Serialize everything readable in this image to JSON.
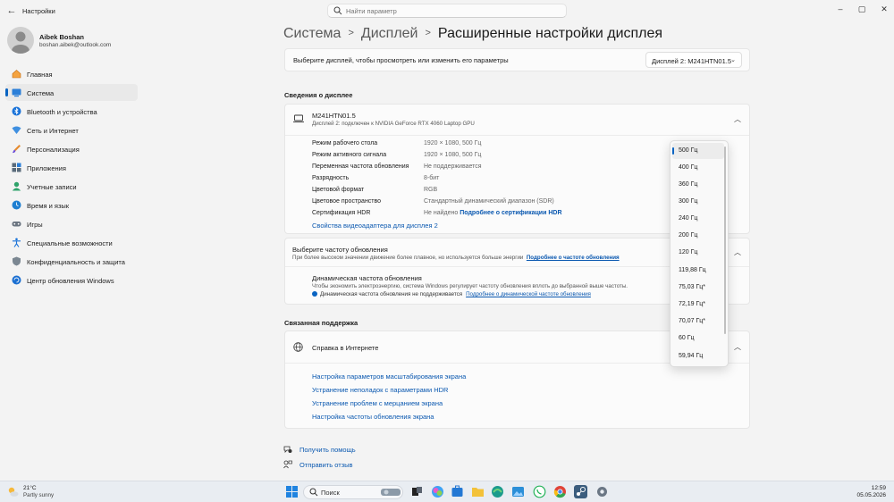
{
  "window": {
    "title": "Настройки",
    "search_placeholder": "Найти параметр"
  },
  "profile": {
    "name": "Aibek Boshan",
    "email": "boshan.aibek@outlook.com"
  },
  "sidebar": {
    "items": [
      {
        "label": "Главная",
        "icon": "home-icon"
      },
      {
        "label": "Система",
        "icon": "system-icon",
        "active": true
      },
      {
        "label": "Bluetooth и устройства",
        "icon": "bluetooth-icon"
      },
      {
        "label": "Сеть и Интернет",
        "icon": "network-icon"
      },
      {
        "label": "Персонализация",
        "icon": "brush-icon"
      },
      {
        "label": "Приложения",
        "icon": "apps-icon"
      },
      {
        "label": "Учетные записи",
        "icon": "account-icon"
      },
      {
        "label": "Время и язык",
        "icon": "globe-clock-icon"
      },
      {
        "label": "Игры",
        "icon": "gamepad-icon"
      },
      {
        "label": "Специальные возможности",
        "icon": "accessibility-icon"
      },
      {
        "label": "Конфиденциальность и защита",
        "icon": "shield-icon"
      },
      {
        "label": "Центр обновления Windows",
        "icon": "update-icon"
      }
    ]
  },
  "breadcrumb": {
    "items": [
      "Система",
      "Дисплей"
    ],
    "current": "Расширенные настройки дисплея"
  },
  "display_select": {
    "label": "Выберите дисплей, чтобы просмотреть или изменить его параметры",
    "value": "Дисплей 2: M241HTN01.5"
  },
  "display_info": {
    "heading": "Сведения о дисплее",
    "monitor_name": "M241HTN01.5",
    "monitor_sub": "Дисплей 2: подключен к NVIDIA GeForce RTX 4060 Laptop GPU",
    "rows": [
      {
        "key": "Режим рабочего стола",
        "value": "1920 × 1080, 500 Гц"
      },
      {
        "key": "Режим активного сигнала",
        "value": "1920 × 1080, 500 Гц"
      },
      {
        "key": "Переменная частота обновления",
        "value": "Не поддерживается"
      },
      {
        "key": "Разрядность",
        "value": "8-бит"
      },
      {
        "key": "Цветовой формат",
        "value": "RGB"
      },
      {
        "key": "Цветовое пространство",
        "value": "Стандартный динамический диапазон (SDR)"
      },
      {
        "key": "Сертификация HDR",
        "value": "Не найдено",
        "link": "Подробнее о сертификации HDR"
      }
    ],
    "adapter_link": "Свойства видеоадаптера для дисплея 2"
  },
  "refresh": {
    "title": "Выберите частоту обновления",
    "sub": "При более высоком значении движение более плавное, но используется больше энергии",
    "sub_link": "Подробнее о частоте обновления",
    "dynamic_title": "Динамическая частота обновления",
    "dynamic_sub": "Чтобы экономить электроэнергию, система Windows регулирует частоту обновления вплоть до выбранной выше частоты.",
    "dynamic_note": "Динамическая частота обновления не поддерживается",
    "dynamic_link": "Подробнее о динамической частоте обновления"
  },
  "dropdown": {
    "options": [
      "500 Гц",
      "400 Гц",
      "360 Гц",
      "300 Гц",
      "240 Гц",
      "200 Гц",
      "120 Гц",
      "119,88 Гц",
      "75,03 Гц*",
      "72,19 Гц*",
      "70,07 Гц*",
      "60 Гц",
      "59,94 Гц"
    ],
    "selected": "500 Гц"
  },
  "support": {
    "heading": "Связанная поддержка",
    "title": "Справка в Интернете",
    "links": [
      "Настройка параметров масштабирования экрана",
      "Устранение неполадок с параметрами HDR",
      "Устранение проблем с мерцанием экрана",
      "Настройка частоты обновления экрана"
    ]
  },
  "bottom_links": {
    "help": "Получить помощь",
    "feedback": "Отправить отзыв"
  },
  "taskbar": {
    "temp": "21°C",
    "weather": "Partly sunny",
    "search": "Поиск",
    "time": "12:59",
    "date": "05.05.2026"
  },
  "colors": {
    "accent": "#0a64c2",
    "link": "#0a58b0"
  }
}
